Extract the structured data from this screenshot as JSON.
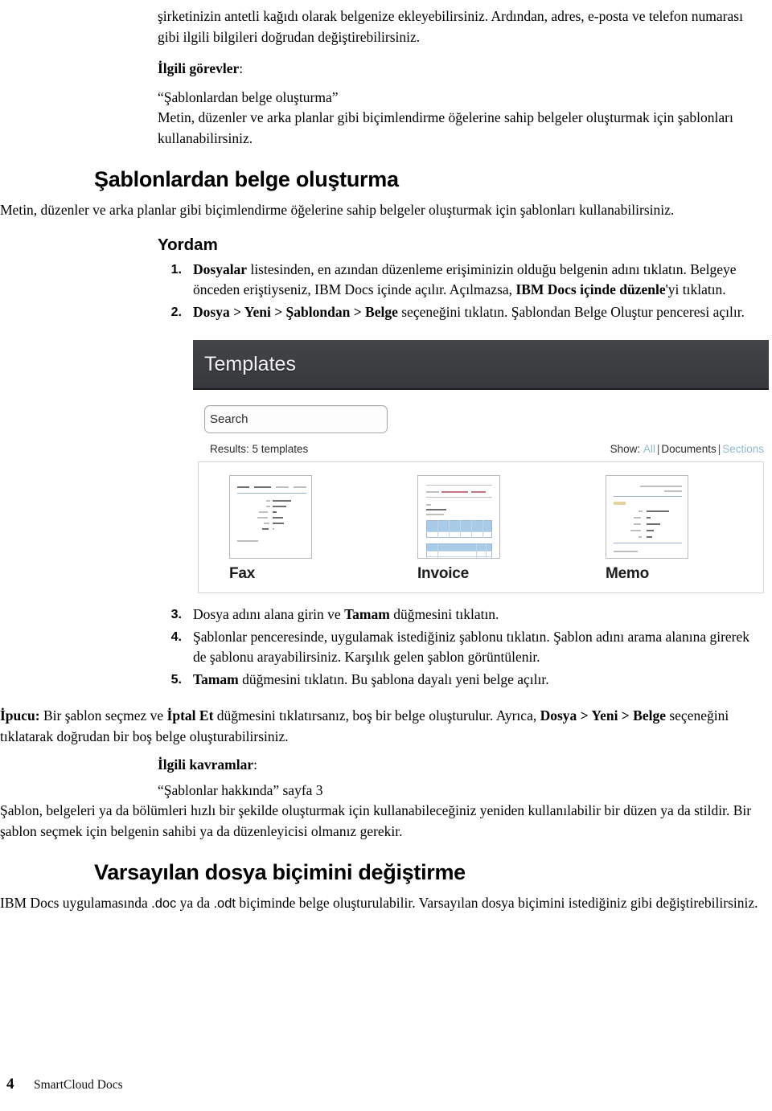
{
  "document": {
    "footer": {
      "page_number": "4",
      "title": "SmartCloud Docs"
    }
  },
  "intro": {
    "paragraph": "şirketinizin antetli kağıdı olarak belgenize ekleyebilirsiniz. Ardından, adres, e-posta ve telefon numarası gibi ilgili bilgileri doğrudan değiştirebilirsiniz.",
    "related_tasks_label": "İlgili görevler",
    "related_tasks_colon": ":",
    "related_link": "“Şablonlardan belge oluşturma”",
    "related_desc": "Metin, düzenler ve arka planlar gibi biçimlendirme öğelerine sahip belgeler oluşturmak için şablonları kullanabilirsiniz."
  },
  "section_create": {
    "heading": "Şablonlardan belge oluşturma",
    "intro": "Metin, düzenler ve arka planlar gibi biçimlendirme öğelerine sahip belgeler oluşturmak için şablonları kullanabilirsiniz.",
    "procedure_heading": "Yordam",
    "steps": [
      {
        "num": "1.",
        "parts": [
          {
            "text": "Dosyalar",
            "bold": true
          },
          {
            "text": " listesinden, en azından düzenleme erişiminizin olduğu belgenin adını tıklatın. Belgeye önceden eriştiyseniz, IBM Docs içinde açılır. Açılmazsa, ",
            "bold": false
          },
          {
            "text": "IBM Docs içinde düzenle",
            "bold": true
          },
          {
            "text": "'yi tıklatın.",
            "bold": false
          }
        ]
      },
      {
        "num": "2.",
        "parts": [
          {
            "text": "Dosya > Yeni > Şablondan > Belge",
            "bold": true
          },
          {
            "text": " seçeneğini tıklatın. Şablondan Belge Oluştur penceresi açılır.",
            "bold": false
          }
        ]
      },
      {
        "num": "3.",
        "parts": [
          {
            "text": "Dosya adını alana girin ve ",
            "bold": false
          },
          {
            "text": "Tamam",
            "bold": true
          },
          {
            "text": " düğmesini tıklatın.",
            "bold": false
          }
        ]
      },
      {
        "num": "4.",
        "parts": [
          {
            "text": "Şablonlar penceresinde, uygulamak istediğiniz şablonu tıklatın. Şablon adını arama alanına girerek de şablonu arayabilirsiniz. Karşılık gelen şablon görüntülenir.",
            "bold": false
          }
        ]
      },
      {
        "num": "5.",
        "parts": [
          {
            "text": "Tamam",
            "bold": true
          },
          {
            "text": " düğmesini tıklatın. Bu şablona dayalı yeni belge açılır.",
            "bold": false
          }
        ]
      }
    ],
    "tip": {
      "label": "İpucu:",
      "parts": [
        {
          "text": " Bir şablon seçmez ve ",
          "bold": false
        },
        {
          "text": "İptal Et",
          "bold": true
        },
        {
          "text": " düğmesini tıklatırsanız, boş bir belge oluşturulur. Ayrıca, ",
          "bold": false
        },
        {
          "text": "Dosya > Yeni > Belge",
          "bold": true
        },
        {
          "text": " seçeneğini tıklatarak doğrudan bir boş belge oluşturabilirsiniz.",
          "bold": false
        }
      ]
    },
    "related_concepts_label": "İlgili kavramlar",
    "related_concepts_colon": ":",
    "related_concepts_link": "“Şablonlar hakkında” sayfa 3",
    "related_concepts_desc": "Şablon, belgeleri ya da bölümleri hızlı bir şekilde oluşturmak için kullanabileceğiniz yeniden kullanılabilir bir düzen ya da stildir. Bir şablon seçmek için belgenin sahibi ya da düzenleyicisi olmanız gerekir."
  },
  "screenshot": {
    "window_title": "Templates",
    "search_placeholder": "Search",
    "results_text": "Results: 5 templates",
    "show_label": "Show:",
    "show_options": [
      {
        "label": "All",
        "link": true
      },
      {
        "label": "Documents",
        "link": false
      },
      {
        "label": "Sections",
        "link": true
      }
    ],
    "separator": "|",
    "templates": [
      {
        "name": "Fax"
      },
      {
        "name": "Invoice"
      },
      {
        "name": "Memo"
      }
    ],
    "colors": {
      "header_bg": "#3b3d40",
      "header_text": "#f2f2f2",
      "link": "#8fb9cf",
      "table_header": "#a8cbe8"
    }
  },
  "section_format": {
    "heading": "Varsayılan dosya biçimini değiştirme",
    "paragraph_parts": [
      {
        "text": "IBM Docs uygulamasında ",
        "mono": false
      },
      {
        "text": ".doc",
        "mono": true
      },
      {
        "text": " ya da ",
        "mono": false
      },
      {
        "text": ".odt",
        "mono": true
      },
      {
        "text": " biçiminde belge oluşturulabilir. Varsayılan dosya biçimini istediğiniz gibi değiştirebilirsiniz.",
        "mono": false
      }
    ]
  }
}
